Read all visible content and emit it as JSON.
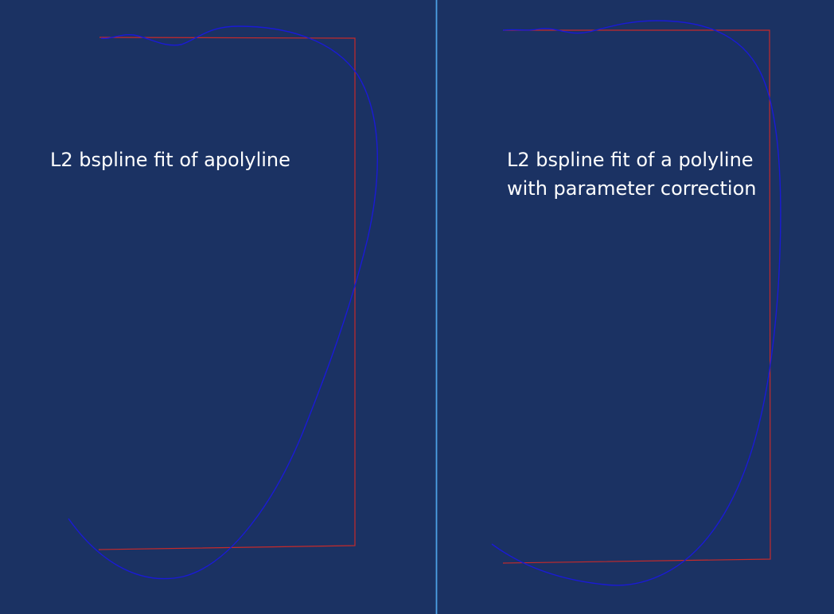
{
  "colors": {
    "background": "#1b3263",
    "polyline": "#c62a2a",
    "bspline": "#1a1ad6",
    "caption": "#ffffff",
    "splitter": "#4d9fe8"
  },
  "panels": [
    {
      "caption_lines": [
        "L2 bspline fit of apolyline"
      ]
    },
    {
      "caption_lines": [
        "L2 bspline fit of a polyline",
        "with parameter correction"
      ]
    }
  ]
}
